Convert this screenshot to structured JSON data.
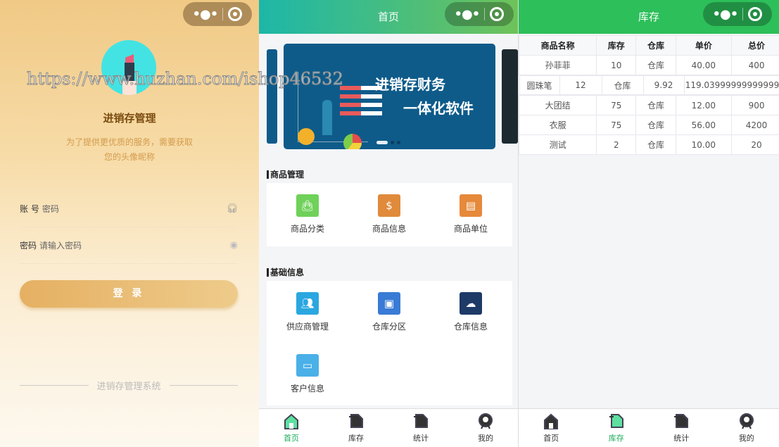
{
  "watermark": "https://www.huzhan.com/ishop46532",
  "login": {
    "title": "进销存管理",
    "subtitle_1": "为了提供更优质的服务，需要获取",
    "subtitle_2": "您的头像昵称",
    "account_label": "账 号",
    "account_placeholder": "密码",
    "password_label": "密码",
    "password_placeholder": "请输入密码",
    "login_button": "登 录",
    "footer": "进销存管理系统"
  },
  "home": {
    "title": "首页",
    "banner_line1": "进销存财务",
    "banner_line2": "一体化软件",
    "section1": "商品管理",
    "section1_items": [
      {
        "label": "商品分类",
        "color": "#6fd15a",
        "icon": "bag-icon"
      },
      {
        "label": "商品信息",
        "color": "#e08a3c",
        "icon": "dollar-bag-icon"
      },
      {
        "label": "商品单位",
        "color": "#e6893a",
        "icon": "document-icon"
      }
    ],
    "section2": "基础信息",
    "section2_items": [
      {
        "label": "供应商管理",
        "color": "#2aa7e0",
        "icon": "users-icon"
      },
      {
        "label": "仓库分区",
        "color": "#3a7bd5",
        "icon": "board-icon"
      },
      {
        "label": "仓库信息",
        "color": "#1e3a66",
        "icon": "cloud-icon"
      },
      {
        "label": "客户信息",
        "color": "#4ab0e8",
        "icon": "id-card-icon"
      }
    ]
  },
  "tabs": [
    {
      "label": "首页"
    },
    {
      "label": "库存"
    },
    {
      "label": "统计"
    },
    {
      "label": "我的"
    }
  ],
  "stock": {
    "title": "库存",
    "headers": [
      "商品名称",
      "库存",
      "仓库",
      "单价",
      "总价"
    ],
    "rows": [
      [
        "孙菲菲",
        "10",
        "仓库",
        "40.00",
        "400"
      ],
      [
        "圆珠笔",
        "12",
        "仓库",
        "9.92",
        "119.03999999999999"
      ],
      [
        "大团结",
        "75",
        "仓库",
        "12.00",
        "900"
      ],
      [
        "衣服",
        "75",
        "仓库",
        "56.00",
        "4200"
      ],
      [
        "测试",
        "2",
        "仓库",
        "10.00",
        "20"
      ]
    ]
  },
  "colors": {
    "active_tab": "#1aad5a",
    "stock_header": "#2dbf5a",
    "login_button": "#e5b062"
  }
}
